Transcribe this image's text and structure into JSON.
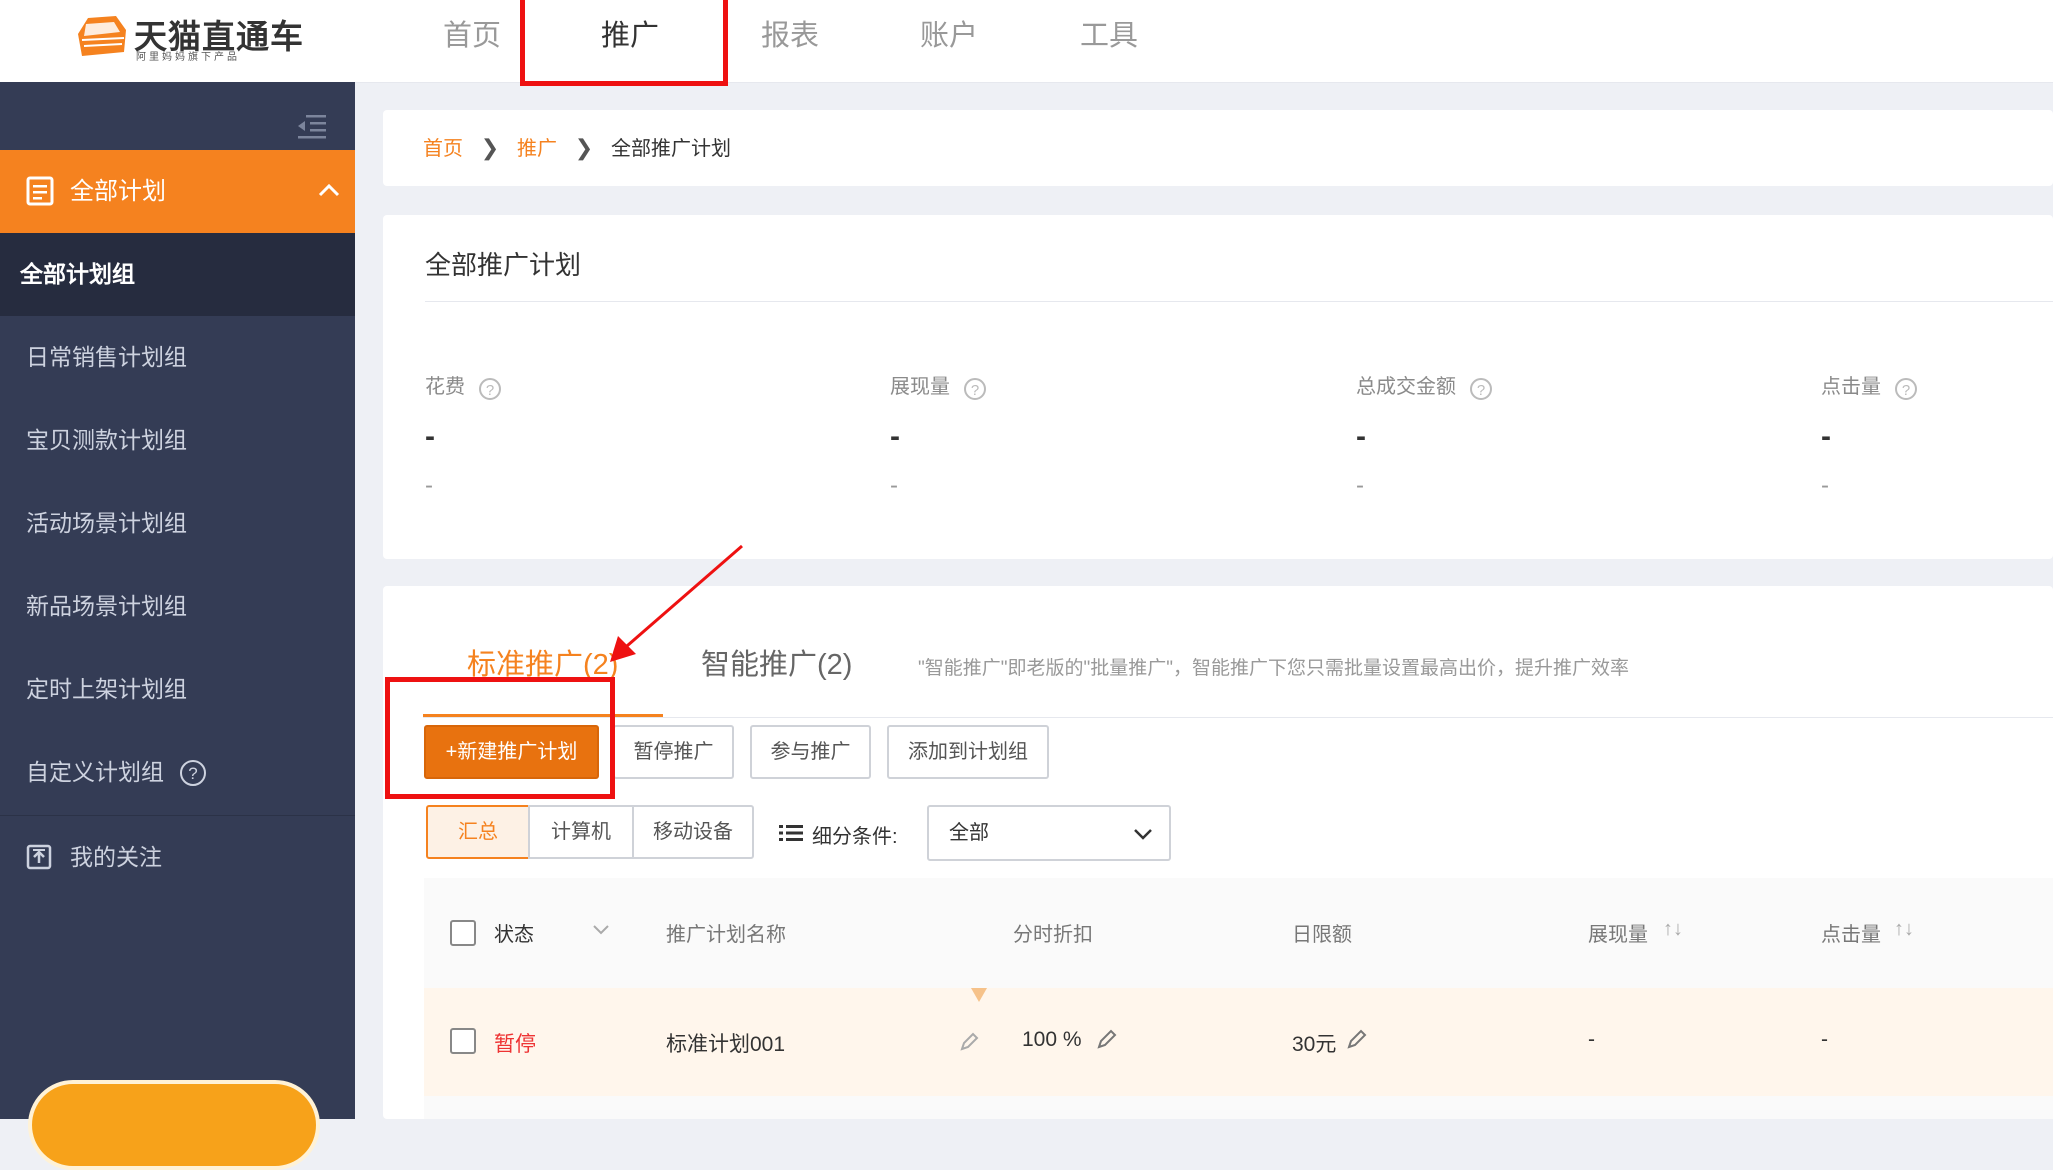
{
  "header": {
    "logo_title": "天猫直通车",
    "logo_subtitle": "阿里妈妈旗下产品",
    "nav": [
      {
        "label": "首页"
      },
      {
        "label": "推广"
      },
      {
        "label": "报表"
      },
      {
        "label": "账户"
      },
      {
        "label": "工具"
      }
    ],
    "active_nav": "推广"
  },
  "sidebar": {
    "section_label": "全部计划",
    "selected_item": "全部计划组",
    "items": [
      {
        "label": "日常销售计划组"
      },
      {
        "label": "宝贝测款计划组"
      },
      {
        "label": "活动场景计划组"
      },
      {
        "label": "新品场景计划组"
      },
      {
        "label": "定时上架计划组"
      },
      {
        "label": "自定义计划组"
      }
    ],
    "follow_label": "我的关注"
  },
  "breadcrumb": {
    "home": "首页",
    "promo": "推广",
    "current": "全部推广计划"
  },
  "overview": {
    "title": "全部推广计划",
    "metrics": [
      {
        "label": "花费",
        "value": "-",
        "sub": "-"
      },
      {
        "label": "展现量",
        "value": "-",
        "sub": "-"
      },
      {
        "label": "总成交金额",
        "value": "-",
        "sub": "-"
      },
      {
        "label": "点击量",
        "value": "-",
        "sub": "-"
      }
    ]
  },
  "tabs": {
    "standard": "标准推广(2)",
    "smart": "智能推广(2)",
    "hint": "\"智能推广\"即老版的\"批量推广\"，智能推广下您只需批量设置最高出价，提升推广效率"
  },
  "actions": {
    "new_plan": "+新建推广计划",
    "pause": "暂停推广",
    "join": "参与推广",
    "add_group": "添加到计划组"
  },
  "device_tabs": [
    "汇总",
    "计算机",
    "移动设备"
  ],
  "filter": {
    "label": "细分条件:",
    "value": "全部"
  },
  "table": {
    "headers": {
      "status": "状态",
      "name": "推广计划名称",
      "discount": "分时折扣",
      "daily_limit": "日限额",
      "impressions": "展现量",
      "clicks": "点击量"
    },
    "rows": [
      {
        "status": "暂停",
        "name": "标准计划001",
        "discount": "100 %",
        "daily_limit": "30元",
        "impressions": "-",
        "clicks": "-"
      }
    ]
  },
  "colors": {
    "accent": "#f5821f",
    "sidebar_bg": "#343c55",
    "highlight_box": "#ee1111",
    "status_paused": "#ee3333"
  }
}
